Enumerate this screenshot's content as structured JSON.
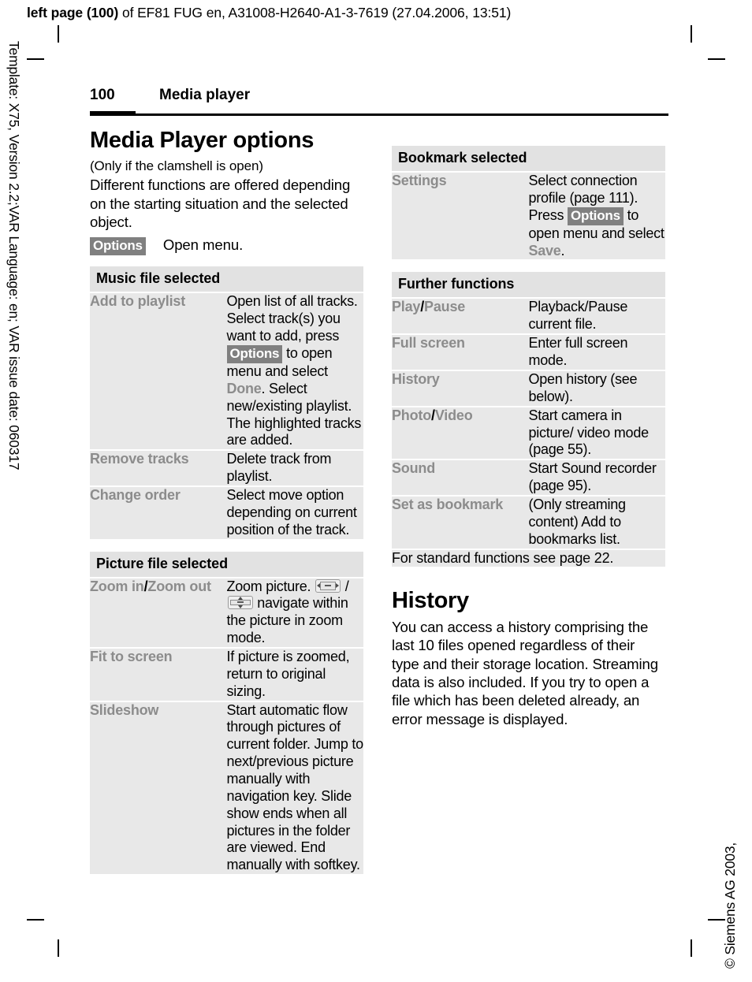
{
  "print_header": {
    "bold_prefix": "left page (100)",
    "rest": " of EF81 FUG en, A31008-H2640-A1-3-7619 (27.04.2006, 13:51)"
  },
  "margin_notes": {
    "left": "Template: X75, Version 2.2;VAR Language: en; VAR issue date: 060317",
    "right": "© Siemens AG 2003,"
  },
  "running_head": {
    "page_number": "100",
    "chapter": "Media player"
  },
  "left_column": {
    "heading": "Media Player options",
    "subnote": "(Only if the clamshell is open)",
    "intro": "Different functions are offered depending on the starting situation and the selected object.",
    "softkey_line": {
      "key": "Options",
      "description": "Open menu."
    },
    "tables": [
      {
        "header": "Music file selected",
        "rows": [
          {
            "key": "Add to playlist",
            "value_parts": [
              {
                "t": "text",
                "v": "Open list of all tracks. Select track(s) you want to add, press "
              },
              {
                "t": "softkey",
                "v": "Options"
              },
              {
                "t": "text",
                "v": " to open menu and select "
              },
              {
                "t": "gray",
                "v": "Done"
              },
              {
                "t": "text",
                "v": ". Select new/existing playlist. The highlighted tracks are added."
              }
            ]
          },
          {
            "key": "Remove tracks",
            "value_parts": [
              {
                "t": "text",
                "v": "Delete track from playlist."
              }
            ]
          },
          {
            "key": "Change order",
            "value_parts": [
              {
                "t": "text",
                "v": "Select move option depending on current position of the track."
              }
            ]
          }
        ]
      },
      {
        "header": "Picture file selected",
        "rows": [
          {
            "key_parts": [
              {
                "t": "gray",
                "v": "Zoom in"
              },
              {
                "t": "black",
                "v": "/"
              },
              {
                "t": "gray",
                "v": "Zoom out"
              }
            ],
            "value_parts": [
              {
                "t": "text",
                "v": "Zoom picture. "
              },
              {
                "t": "icon",
                "v": "navkey-horizontal-icon"
              },
              {
                "t": "text",
                "v": " / "
              },
              {
                "t": "icon",
                "v": "navkey-vertical-icon"
              },
              {
                "t": "text",
                "v": " navigate within the picture in zoom mode."
              }
            ]
          },
          {
            "key": "Fit to screen",
            "value_parts": [
              {
                "t": "text",
                "v": "If picture is zoomed, return to original sizing."
              }
            ]
          },
          {
            "key": "Slideshow",
            "value_parts": [
              {
                "t": "text",
                "v": "Start automatic flow through pictures of current folder. Jump to next/previous picture manually with navigation key. Slide show ends when all pictures in the folder are viewed. End manually with softkey."
              }
            ]
          }
        ]
      }
    ]
  },
  "right_column": {
    "tables": [
      {
        "header": "Bookmark selected",
        "rows": [
          {
            "key": "Settings",
            "value_parts": [
              {
                "t": "text",
                "v": "Select connection profile (page 111)."
              },
              {
                "t": "break",
                "v": ""
              },
              {
                "t": "text",
                "v": "Press "
              },
              {
                "t": "softkey",
                "v": "Options"
              },
              {
                "t": "text",
                "v": " to open menu and select "
              },
              {
                "t": "gray",
                "v": "Save"
              },
              {
                "t": "text",
                "v": "."
              }
            ]
          }
        ]
      },
      {
        "header": "Further functions",
        "rows": [
          {
            "key_parts": [
              {
                "t": "gray",
                "v": "Play"
              },
              {
                "t": "black",
                "v": "/"
              },
              {
                "t": "gray",
                "v": "Pause"
              }
            ],
            "value_parts": [
              {
                "t": "text",
                "v": "Playback/Pause current file."
              }
            ]
          },
          {
            "key": "Full screen",
            "value_parts": [
              {
                "t": "text",
                "v": "Enter full screen mode."
              }
            ]
          },
          {
            "key": "History",
            "value_parts": [
              {
                "t": "text",
                "v": "Open history (see below)."
              }
            ]
          },
          {
            "key_parts": [
              {
                "t": "gray",
                "v": "Photo"
              },
              {
                "t": "black",
                "v": "/"
              },
              {
                "t": "gray",
                "v": "Video"
              }
            ],
            "value_parts": [
              {
                "t": "text",
                "v": "Start camera in picture/ video mode (page 55)."
              }
            ]
          },
          {
            "key": "Sound",
            "value_parts": [
              {
                "t": "text",
                "v": "Start Sound recorder (page 95)."
              }
            ]
          },
          {
            "key": "Set as bookmark",
            "value_parts": [
              {
                "t": "text",
                "v": "(Only streaming content) Add to bookmarks list."
              }
            ]
          }
        ],
        "footer": "For standard functions see page 22."
      }
    ],
    "history": {
      "heading": "History",
      "body": "You can access a history comprising the last 10 files opened regardless of their type and their storage location. Streaming data is also included. If you try to open a file which has been deleted already, an error message is displayed."
    }
  },
  "colors": {
    "table_header_bg": "#e2e2e2",
    "table_row_bg": "#e8e8e8",
    "key_text": "#8c8c8c",
    "softkey_bg": "#808080",
    "softkey_text": "#ffffff"
  }
}
